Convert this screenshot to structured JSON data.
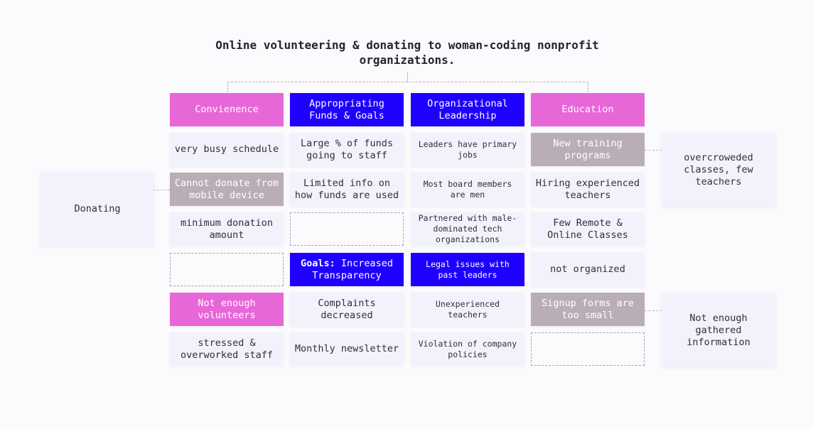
{
  "title": "Online volunteering & donating to woman-coding nonprofit organizations.",
  "columns": [
    {
      "header": "Convienence",
      "cards": [
        {
          "text": "very busy schedule"
        },
        {
          "text": "Cannot donate from mobile device"
        },
        {
          "text": "minimum donation amount"
        },
        {
          "text": ""
        },
        {
          "text": "Not enough volunteers"
        },
        {
          "text": "stressed & overworked staff"
        }
      ]
    },
    {
      "header": "Appropriating Funds & Goals",
      "cards": [
        {
          "text": "Large % of funds going to staff"
        },
        {
          "text": "Limited info on how funds are used"
        },
        {
          "text": ""
        },
        {
          "prefix": "Goals:",
          "text": " Increased Transparency"
        },
        {
          "text": "Complaints decreased"
        },
        {
          "text": "Monthly newsletter"
        }
      ]
    },
    {
      "header": "Organizational Leadership",
      "cards": [
        {
          "text": "Leaders have primary jobs"
        },
        {
          "text": "Most board members are men"
        },
        {
          "text": "Partnered with male-dominated tech organizations"
        },
        {
          "text": "Legal issues with past leaders"
        },
        {
          "text": "Unexperienced teachers"
        },
        {
          "text": "Violation of company policies"
        }
      ]
    },
    {
      "header": "Education",
      "cards": [
        {
          "text": "New training programs"
        },
        {
          "text": "Hiring experienced teachers"
        },
        {
          "text": "Few Remote & Online Classes"
        },
        {
          "text": "not organized"
        },
        {
          "text": "Signup forms are too small"
        },
        {
          "text": ""
        }
      ]
    }
  ],
  "side_notes": {
    "donating": "Donating",
    "overcrowded": "overcroweded classes, few teachers",
    "not_enough_info": "Not enough gathered information"
  },
  "colors": {
    "header_pink": "#e867d8",
    "header_blue": "#1e00ff",
    "highlight_grey": "#b9aeb8",
    "card_bg": "#f2f2fc"
  }
}
